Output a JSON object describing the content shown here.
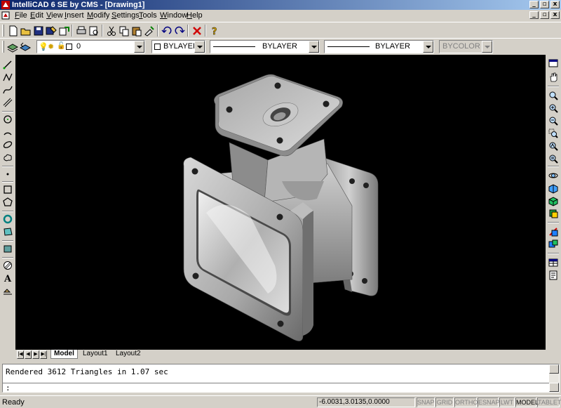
{
  "window": {
    "title": "IntelliCAD 6 SE by CMS - [Drawing1]"
  },
  "menu": [
    {
      "pre": "",
      "u": "F",
      "post": "ile"
    },
    {
      "pre": "",
      "u": "E",
      "post": "dit"
    },
    {
      "pre": "",
      "u": "V",
      "post": "iew"
    },
    {
      "pre": "",
      "u": "I",
      "post": "nsert"
    },
    {
      "pre": "",
      "u": "M",
      "post": "odify"
    },
    {
      "pre": "",
      "u": "S",
      "post": "ettings"
    },
    {
      "pre": "",
      "u": "T",
      "post": "ools"
    },
    {
      "pre": "",
      "u": "W",
      "post": "indow"
    },
    {
      "pre": "",
      "u": "H",
      "post": "elp"
    }
  ],
  "properties": {
    "layer_value": "0",
    "color_value": "BYLAYER",
    "linetype_value": "BYLAYER",
    "lineweight_value": "BYLAYER",
    "plotstyle_value": "BYCOLOR"
  },
  "layout_tabs": [
    {
      "label": "Model",
      "active": true
    },
    {
      "label": "Layout1",
      "active": false
    },
    {
      "label": "Layout2",
      "active": false
    }
  ],
  "command": {
    "history_line": "Rendered 3612 Triangles in 1.07 sec",
    "prompt": ":"
  },
  "status": {
    "message": "Ready",
    "coordinates": "-6.0031,3.0135,0.0000",
    "toggles": [
      {
        "label": "SNAP",
        "on": false
      },
      {
        "label": "GRID",
        "on": false
      },
      {
        "label": "ORTHO",
        "on": false
      },
      {
        "label": "ESNAP",
        "on": false
      },
      {
        "label": "LWT",
        "on": false
      },
      {
        "label": "MODEL",
        "on": true
      },
      {
        "label": "TABLET",
        "on": false
      }
    ]
  },
  "icons": {
    "toolbar_standard": [
      "new-icon",
      "open-icon",
      "save-icon",
      "save-as-icon",
      "export-icon",
      "print-icon",
      "print-preview-icon",
      "cut-icon",
      "copy-icon",
      "paste-icon",
      "match-properties-icon",
      "undo-icon",
      "redo-icon",
      "delete-icon",
      "help-icon"
    ],
    "draw_tools": [
      "line-icon",
      "polyline-icon",
      "spline-icon",
      "multiline-icon",
      "circle-icon",
      "arc-icon",
      "ellipse-icon",
      "revision-cloud-icon",
      "point-icon",
      "rectangle-icon",
      "polygon-icon",
      "donut-icon",
      "region-icon",
      "wipeout-icon",
      "hatch-icon",
      "text-icon",
      "insert-block-icon"
    ],
    "view_tools": [
      "view-properties-icon",
      "pan-icon",
      "zoom-realtime-icon",
      "zoom-in-icon",
      "zoom-out-icon",
      "zoom-window-icon",
      "zoom-all-icon",
      "zoom-extents-icon",
      "orbit-icon",
      "render-icon",
      "shade-icon",
      "layers-icon",
      "viewpoint-icon",
      "named-views-icon",
      "table-icon",
      "properties-icon"
    ]
  },
  "colors": {
    "viewport_bg": "#000000",
    "title_start": "#0a246a",
    "title_end": "#a6caf0",
    "chrome": "#d4d0c8"
  }
}
